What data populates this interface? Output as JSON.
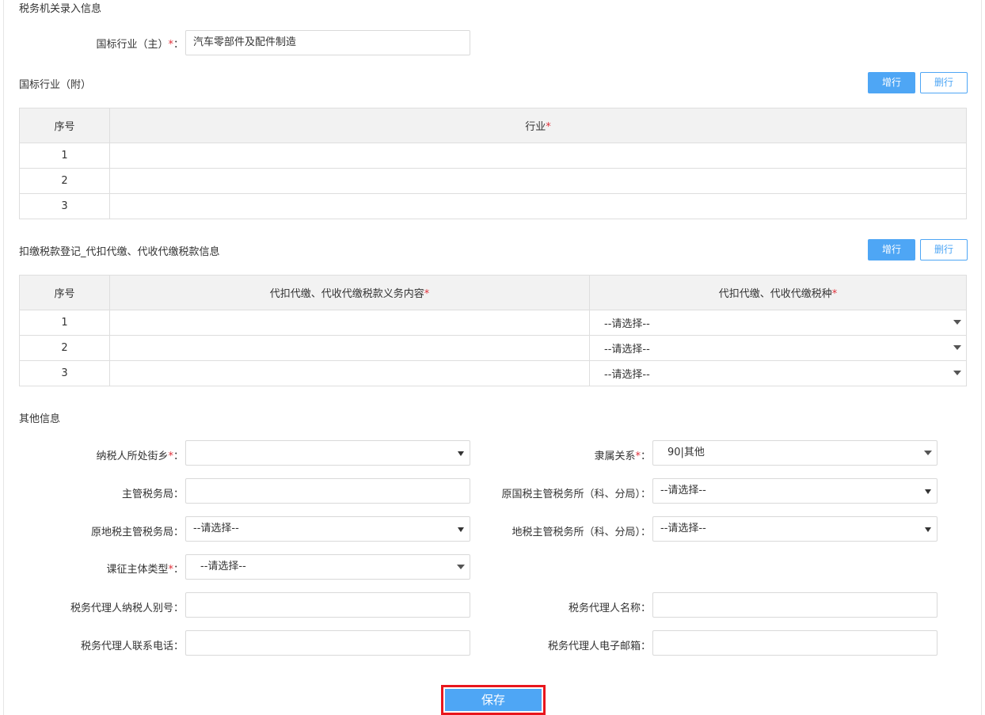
{
  "tax_office": {
    "title": "税务机关录入信息",
    "main_industry_label": "国标行业（主）",
    "main_industry_value": "汽车零部件及配件制造"
  },
  "sub_industry": {
    "title": "国标行业（附）",
    "add_label": "增行",
    "del_label": "删行",
    "headers": [
      "序号",
      "行业"
    ],
    "rows": [
      "1",
      "2",
      "3"
    ]
  },
  "withholding": {
    "title": "扣缴税款登记_代扣代缴、代收代缴税款信息",
    "add_label": "增行",
    "del_label": "删行",
    "headers": [
      "序号",
      "代扣代缴、代收代缴税款义务内容",
      "代扣代缴、代收代缴税种"
    ],
    "rows": [
      {
        "no": "1",
        "tax_type": "--请选择--"
      },
      {
        "no": "2",
        "tax_type": "--请选择--"
      },
      {
        "no": "3",
        "tax_type": "--请选择--"
      }
    ]
  },
  "other": {
    "title": "其他信息",
    "street_label": "纳税人所处街乡",
    "street_value": "",
    "affiliation_label": "隶属关系",
    "affiliation_value": "90|其他",
    "tax_bureau_label": "主管税务局",
    "tax_bureau_value": "",
    "national_office_label": "原国税主管税务所（科、分局）",
    "national_office_value": "--请选择--",
    "local_bureau_label": "原地税主管税务局",
    "local_bureau_value": "--请选择--",
    "local_office_label": "地税主管税务所（科、分局）",
    "local_office_value": "--请选择--",
    "subject_type_label": "课征主体类型",
    "subject_type_value": "--请选择--",
    "agent_id_label": "税务代理人纳税人别号",
    "agent_id_value": "",
    "agent_name_label": "税务代理人名称",
    "agent_name_value": "",
    "agent_phone_label": "税务代理人联系电话",
    "agent_phone_value": "",
    "agent_email_label": "税务代理人电子邮箱",
    "agent_email_value": ""
  },
  "colon": "：",
  "required_mark": "*",
  "save_label": "保存",
  "colors": {
    "primary": "#4ea6f5",
    "required": "#e0303a",
    "highlight": "#e8161d"
  }
}
